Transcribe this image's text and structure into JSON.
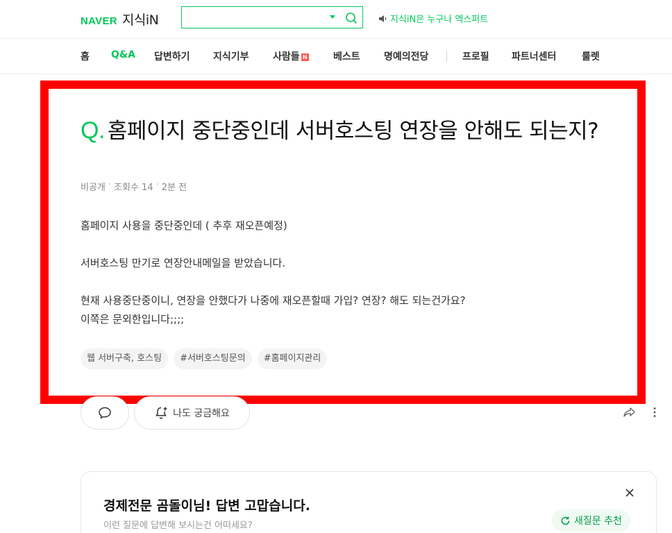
{
  "header": {
    "logo_naver": "NAVER",
    "logo_service": "지식iN",
    "search_placeholder": "",
    "notice": "지식iN은 누구나 엑스퍼트"
  },
  "nav": {
    "items": [
      "홈",
      "Q&A",
      "답변하기",
      "지식기부",
      "사람들",
      "베스트",
      "명예의전당",
      "프로필",
      "파트너센터",
      "룰렛"
    ],
    "active": "Q&A",
    "new_badge": "N"
  },
  "question": {
    "mark": "Q.",
    "title": "홈페이지 중단중인데 서버호스팅 연장을 안해도 되는지?",
    "author": "비공개",
    "views": "조회수 14",
    "time": "2분 전",
    "body": [
      "홈페이지 사용을 중단중인데 ( 추후 재오픈예정)",
      "서버호스팅 만기로 연장안내메일을 받았습니다.",
      "현재 사용중단중이니, 연장을 안했다가 나중에 재오픈할때 가입? 연장? 해도 되는건가요?",
      "이쪽은 문외한입니다;;;;"
    ],
    "tags": [
      "웹 서버구축, 호스팅",
      "#서버호스팅문의",
      "#홈페이지관리"
    ]
  },
  "actions": {
    "curious_label": "나도 궁금해요"
  },
  "recommend": {
    "title": "경제전문 곰돌이님! 답변 고맙습니다.",
    "subtitle": "이런 질문에 답변해 보시는건 어떠세요?",
    "button": "새질문 추천"
  },
  "colors": {
    "brand": "#03c75a",
    "highlight_frame": "#ff0000"
  }
}
